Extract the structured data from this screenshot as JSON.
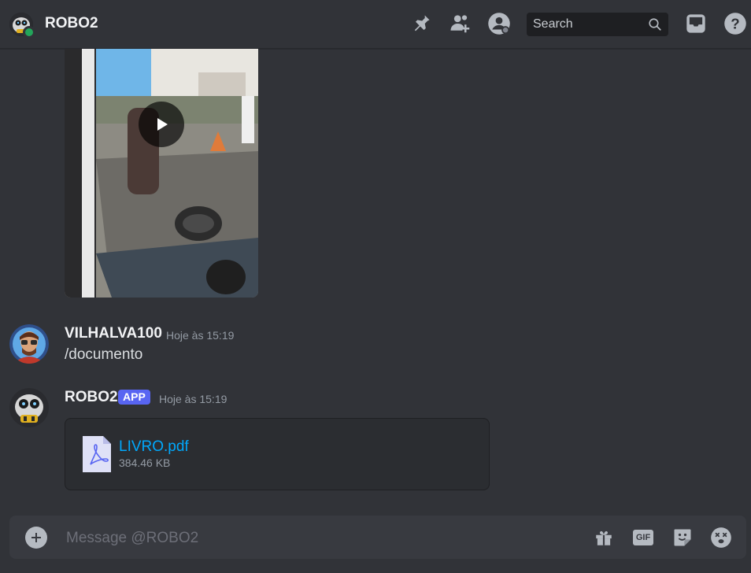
{
  "header": {
    "title": "ROBO2",
    "search_placeholder": "Search",
    "icons": [
      "pin-icon",
      "add-friend-icon",
      "user-profile-icon",
      "search-icon",
      "inbox-icon",
      "help-icon"
    ],
    "status_color": "#23a55a"
  },
  "messages": [
    {
      "author": "VILHALVA100",
      "timestamp": "Hoje às 15:19",
      "text": "/documento"
    },
    {
      "author": "ROBO2",
      "badge": "APP",
      "timestamp": "Hoje às 15:19",
      "attachment": {
        "name": "LIVRO.pdf",
        "size": "384.46 KB"
      }
    }
  ],
  "composer": {
    "placeholder": "Message @ROBO2",
    "gif_label": "GIF",
    "icons": [
      "add-icon",
      "gift-icon",
      "gif-icon",
      "sticker-icon",
      "emoji-icon"
    ]
  },
  "colors": {
    "accent": "#5865f2",
    "link": "#00a8fc",
    "background": "#313338"
  }
}
